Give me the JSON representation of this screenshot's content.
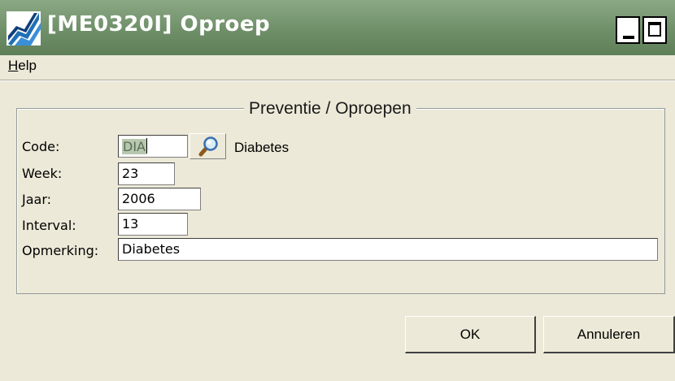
{
  "window": {
    "title": "[ME0320I] Oproep",
    "minimize_label": "_",
    "maximize_label": "□"
  },
  "menu": {
    "help_accel": "H",
    "help_rest": "elp"
  },
  "group": {
    "title": "Preventie / Oproepen"
  },
  "form": {
    "code": {
      "label": "Code:",
      "value": "DIA",
      "description": "Diabetes"
    },
    "week": {
      "label": "Week:",
      "value": "23"
    },
    "year": {
      "label": "Jaar:",
      "value": "2006"
    },
    "interval": {
      "label": "Interval:",
      "value": "13"
    },
    "remark": {
      "label": "Opmerking:",
      "value": "Diabetes"
    }
  },
  "buttons": {
    "ok": "OK",
    "cancel": "Annuleren"
  },
  "colors": {
    "titlebar": "#6f8f69",
    "background": "#ece9d8",
    "selection": "#b8c8b0"
  },
  "icons": {
    "app": "app-logo-icon",
    "search": "search-icon"
  }
}
